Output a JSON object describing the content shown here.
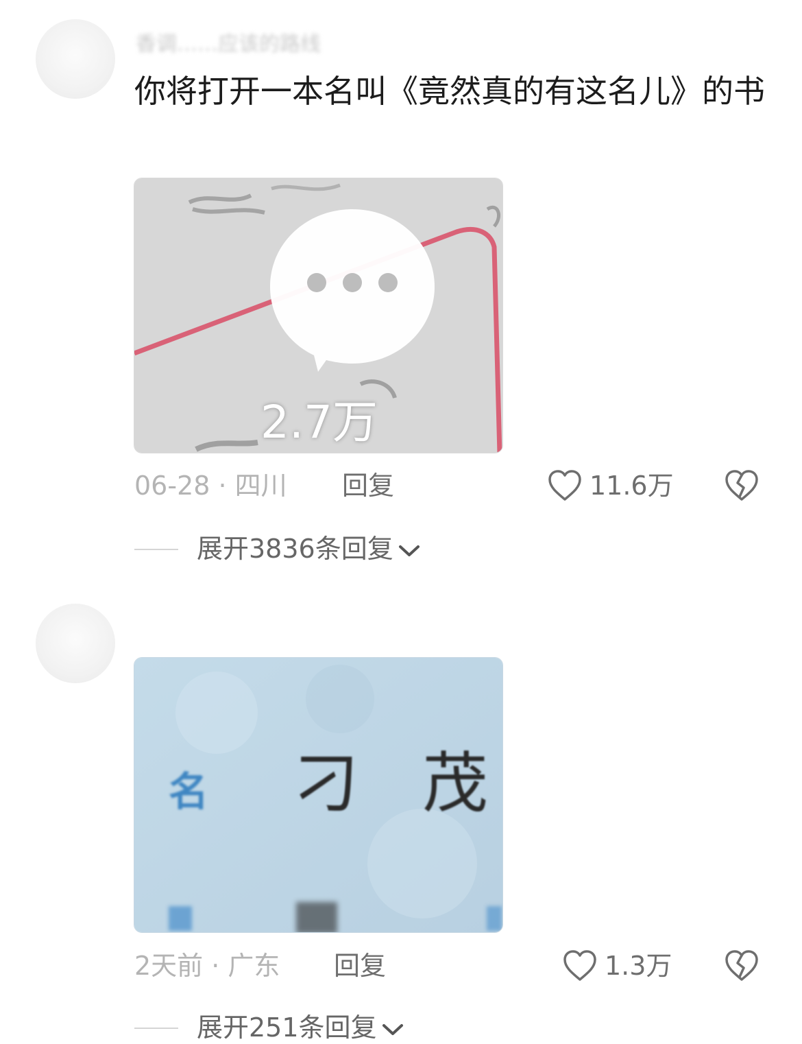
{
  "comments": [
    {
      "username": "香调……应该的路线",
      "text": "你将打开一本名叫《竟然真的有这名儿》的书",
      "image_overlay_count": "2.7万",
      "date": "06-28 · 四川",
      "reply_label": "回复",
      "likes": "11.6万",
      "expand_label": "展开3836条回复"
    },
    {
      "username": "",
      "image_chars": {
        "label_name": "名",
        "char1": "刁",
        "char2": "茂"
      },
      "date": "2天前 · 广东",
      "reply_label": "回复",
      "likes": "1.3万",
      "expand_label": "展开251条回复"
    }
  ],
  "colors": {
    "text_primary": "#1c1c1c",
    "text_meta": "#b4b4b4",
    "text_action": "#6e6e6e",
    "card_blue": "#bcd5e6",
    "card_gray": "#d2d2d2",
    "red_line": "#d9556d"
  }
}
